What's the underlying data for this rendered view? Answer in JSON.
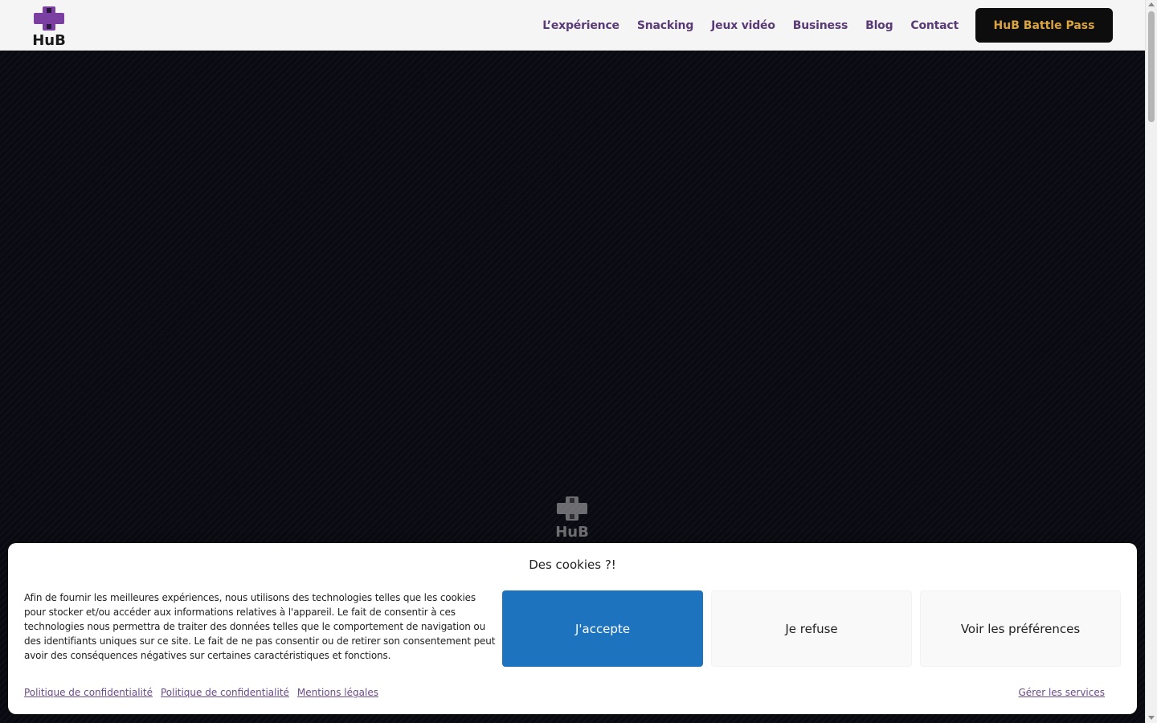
{
  "header": {
    "logo_text": "HuB",
    "nav": [
      "L’expérience",
      "Snacking",
      "Jeux vidéo",
      "Business",
      "Blog",
      "Contact"
    ],
    "cta_label": "HuB Battle Pass"
  },
  "hero": {
    "logo_text": "HuB"
  },
  "cookie": {
    "title": "Des cookies ?!",
    "text": "Afin de fournir les meilleures expériences, nous utilisons des technologies telles que les cookies pour stocker et/ou accéder aux informations relatives à l'appareil. Le fait de consentir à ces technologies nous permettra de traiter des données telles que le comportement de navigation ou des identifiants uniques sur ce site. Le fait de ne pas consentir ou de retirer son consentement peut avoir des conséquences négatives sur certaines caractéristiques et fonctions.",
    "accept_label": "J'accepte",
    "refuse_label": "Je refuse",
    "prefs_label": "Voir les préférences",
    "links": [
      "Politique de confidentialité",
      "Politique de confidentialité",
      "Mentions légales"
    ],
    "manage_label": "Gérer les services"
  },
  "colors": {
    "brand_purple": "#5a3b76",
    "accent_gold": "#d9a441",
    "accept_blue": "#1e73be",
    "hero_bg": "#0a0a12"
  }
}
